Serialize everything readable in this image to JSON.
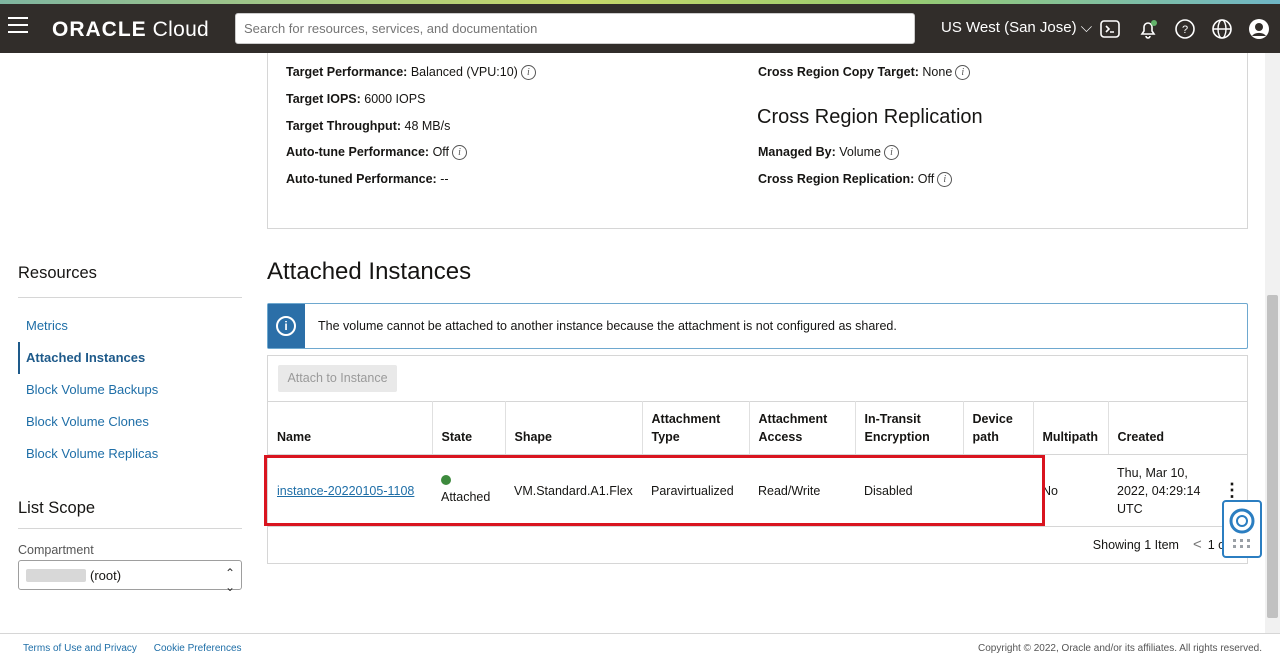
{
  "topbar": {
    "logo_brand": "ORACLE",
    "logo_product": "Cloud",
    "search_placeholder": "Search for resources, services, and documentation",
    "region": "US West (San Jose)",
    "icons": [
      "hamburger-menu-icon",
      "cloud-shell-icon",
      "notifications-icon",
      "help-icon",
      "language-icon",
      "profile-icon"
    ]
  },
  "details": {
    "target_performance_label": "Target Performance:",
    "target_performance_value": "Balanced (VPU:10)",
    "target_iops_label": "Target IOPS:",
    "target_iops_value": "6000 IOPS",
    "target_throughput_label": "Target Throughput:",
    "target_throughput_value": "48 MB/s",
    "autotune_label": "Auto-tune Performance:",
    "autotune_value": "Off",
    "autotuned_label": "Auto-tuned Performance:",
    "autotuned_value": "--",
    "crr_copy_label": "Cross Region Copy Target:",
    "crr_copy_value": "None",
    "crr_heading": "Cross Region Replication",
    "managed_by_label": "Managed By:",
    "managed_by_value": "Volume",
    "crr_label": "Cross Region Replication:",
    "crr_value": "Off"
  },
  "sidebar": {
    "resources_title": "Resources",
    "items": [
      {
        "label": "Metrics"
      },
      {
        "label": "Attached Instances"
      },
      {
        "label": "Block Volume Backups"
      },
      {
        "label": "Block Volume Clones"
      },
      {
        "label": "Block Volume Replicas"
      }
    ],
    "list_scope_title": "List Scope",
    "compartment_label": "Compartment",
    "compartment_value": "(root)"
  },
  "main": {
    "heading": "Attached Instances",
    "alert_text": "The volume cannot be attached to another instance because the attachment is not configured as shared.",
    "attach_button": "Attach to Instance",
    "columns": [
      "Name",
      "State",
      "Shape",
      "Attachment Type",
      "Attachment Access",
      "In-Transit Encryption",
      "Device path",
      "Multipath",
      "Created"
    ],
    "row": {
      "name": "instance-20220105-1108",
      "state": "Attached",
      "state_color": "#3d8a3d",
      "shape": "VM.Standard.A1.Flex",
      "attachment_type": "Paravirtualized",
      "attachment_access": "Read/Write",
      "encryption": "Disabled",
      "device_path": "",
      "multipath": "No",
      "created": "Thu, Mar 10, 2022, 04:29:14 UTC"
    },
    "pager_text": "Showing 1 Item",
    "pager_page": "1 of 1"
  },
  "footer": {
    "terms": "Terms of Use and Privacy",
    "cookies": "Cookie Preferences",
    "copyright": "Copyright © 2022, Oracle and/or its affiliates. All rights reserved."
  }
}
